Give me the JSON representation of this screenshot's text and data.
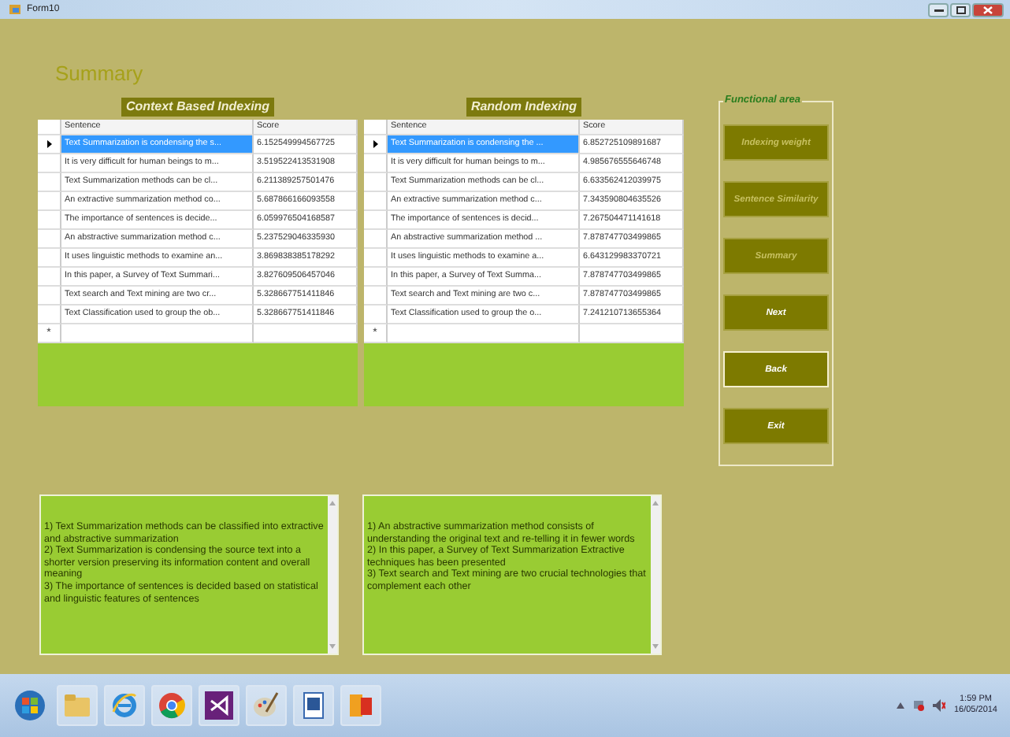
{
  "window": {
    "title": "Form10"
  },
  "heading": "Summary",
  "grids": [
    {
      "caption": "Context Based Indexing",
      "columns": [
        "Sentence",
        "Score"
      ],
      "new_row_marker": "*",
      "rows": [
        {
          "sentence": "Text Summarization is condensing the s...",
          "score": "6.152549994567725",
          "selected": true
        },
        {
          "sentence": "It is very difficult for human beings to m...",
          "score": "3.519522413531908",
          "selected": false
        },
        {
          "sentence": "Text Summarization methods can be cl...",
          "score": "6.211389257501476",
          "selected": false
        },
        {
          "sentence": "An extractive summarization method co...",
          "score": "5.687866166093558",
          "selected": false
        },
        {
          "sentence": "The importance of sentences is decide...",
          "score": "6.059976504168587",
          "selected": false
        },
        {
          "sentence": "An abstractive summarization method c...",
          "score": "5.237529046335930",
          "selected": false
        },
        {
          "sentence": "It uses linguistic methods to examine an...",
          "score": "3.869838385178292",
          "selected": false
        },
        {
          "sentence": "In this paper, a Survey of Text Summari...",
          "score": "3.827609506457046",
          "selected": false
        },
        {
          "sentence": "Text search and Text mining are two cr...",
          "score": "5.328667751411846",
          "selected": false
        },
        {
          "sentence": "Text Classification used to group the ob...",
          "score": "5.328667751411846",
          "selected": false
        }
      ]
    },
    {
      "caption": "Random Indexing",
      "columns": [
        "Sentence",
        "Score"
      ],
      "new_row_marker": "*",
      "rows": [
        {
          "sentence": "Text Summarization is condensing the ...",
          "score": "6.852725109891687",
          "selected": true
        },
        {
          "sentence": "It is very difficult for human beings to m...",
          "score": "4.985676555646748",
          "selected": false
        },
        {
          "sentence": "Text Summarization methods can be cl...",
          "score": "6.633562412039975",
          "selected": false
        },
        {
          "sentence": "An extractive summarization method c...",
          "score": "7.343590804635526",
          "selected": false
        },
        {
          "sentence": "The importance of sentences is decid...",
          "score": "7.267504471141618",
          "selected": false
        },
        {
          "sentence": "An abstractive summarization method ...",
          "score": "7.878747703499865",
          "selected": false
        },
        {
          "sentence": "It uses linguistic methods to examine a...",
          "score": "6.643129983370721",
          "selected": false
        },
        {
          "sentence": "In this paper, a Survey of Text Summa...",
          "score": "7.878747703499865",
          "selected": false
        },
        {
          "sentence": "Text search and Text mining are two c...",
          "score": "7.878747703499865",
          "selected": false
        },
        {
          "sentence": "Text Classification used to group the o...",
          "score": "7.241210713655364",
          "selected": false
        }
      ]
    }
  ],
  "summaries": [
    {
      "lines": [
        "1) Text Summarization methods can be classified into extractive and abstractive summarization",
        "2) Text Summarization is condensing the source text into a shorter version preserving its information content and overall meaning",
        "3) The importance of sentences is decided based on statistical and linguistic features of sentences"
      ]
    },
    {
      "lines": [
        "1) An abstractive summarization method consists of understanding the original text and re-telling it in fewer words",
        "2) In this paper, a Survey of Text Summarization Extractive techniques has been presented",
        "3) Text search and Text mining are two crucial technologies that complement each other"
      ]
    }
  ],
  "functional_area": {
    "title": "Functional area",
    "buttons": [
      {
        "label": "Indexing weight",
        "disabled": true,
        "focused": false
      },
      {
        "label": "Sentence Similarity",
        "disabled": true,
        "focused": false
      },
      {
        "label": "Summary",
        "disabled": true,
        "focused": false
      },
      {
        "label": "Next",
        "disabled": false,
        "focused": false
      },
      {
        "label": "Back",
        "disabled": false,
        "focused": true
      },
      {
        "label": "Exit",
        "disabled": false,
        "focused": false
      }
    ]
  },
  "taskbar": {
    "time": "1:59 PM",
    "date": "16/05/2014"
  }
}
